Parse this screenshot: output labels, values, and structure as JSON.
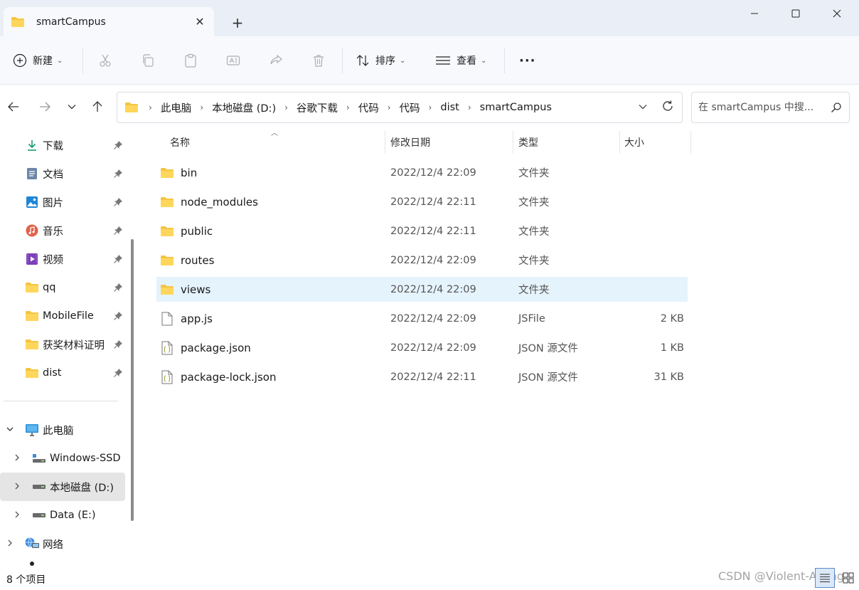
{
  "window": {
    "tab_title": "smartCampus",
    "tab_close_glyph": "✕",
    "new_tab_glyph": "+"
  },
  "toolbar": {
    "new_label": "新建",
    "sort_label": "排序",
    "view_label": "查看",
    "more_glyph": "···"
  },
  "address": {
    "breadcrumbs": [
      "此电脑",
      "本地磁盘 (D:)",
      "谷歌下载",
      "代码",
      "代码",
      "dist",
      "smartCampus"
    ]
  },
  "search": {
    "placeholder": "在 smartCampus 中搜..."
  },
  "sidebar": {
    "quick_access": [
      {
        "label": "下载",
        "icon": "download-icon"
      },
      {
        "label": "文档",
        "icon": "document-icon"
      },
      {
        "label": "图片",
        "icon": "pictures-icon"
      },
      {
        "label": "音乐",
        "icon": "music-icon"
      },
      {
        "label": "视频",
        "icon": "video-icon"
      },
      {
        "label": "qq",
        "icon": "folder-icon"
      },
      {
        "label": "MobileFile",
        "icon": "folder-icon"
      },
      {
        "label": "获奖材料证明",
        "icon": "folder-icon"
      },
      {
        "label": "dist",
        "icon": "folder-icon"
      }
    ],
    "tree": [
      {
        "label": "此电脑",
        "icon": "computer-icon",
        "expander": "expanded"
      },
      {
        "label": "Windows-SSD",
        "icon": "drive-icon",
        "expander": "collapsed"
      },
      {
        "label": "本地磁盘 (D:)",
        "icon": "drive-icon",
        "expander": "collapsed",
        "selected": true
      },
      {
        "label": "Data (E:)",
        "icon": "drive-icon",
        "expander": "collapsed"
      },
      {
        "label": "网络",
        "icon": "network-icon",
        "expander": "collapsed"
      }
    ]
  },
  "filelist": {
    "columns": {
      "name": "名称",
      "date": "修改日期",
      "type": "类型",
      "size": "大小"
    },
    "rows": [
      {
        "name": "bin",
        "date": "2022/12/4 22:09",
        "type": "文件夹",
        "size": "",
        "icon": "folder-icon"
      },
      {
        "name": "node_modules",
        "date": "2022/12/4 22:11",
        "type": "文件夹",
        "size": "",
        "icon": "folder-icon"
      },
      {
        "name": "public",
        "date": "2022/12/4 22:11",
        "type": "文件夹",
        "size": "",
        "icon": "folder-icon"
      },
      {
        "name": "routes",
        "date": "2022/12/4 22:09",
        "type": "文件夹",
        "size": "",
        "icon": "folder-icon"
      },
      {
        "name": "views",
        "date": "2022/12/4 22:09",
        "type": "文件夹",
        "size": "",
        "icon": "folder-icon",
        "hover": true
      },
      {
        "name": "app.js",
        "date": "2022/12/4 22:09",
        "type": "JSFile",
        "size": "2 KB",
        "icon": "file-icon"
      },
      {
        "name": "package.json",
        "date": "2022/12/4 22:09",
        "type": "JSON 源文件",
        "size": "1 KB",
        "icon": "json-file-icon"
      },
      {
        "name": "package-lock.json",
        "date": "2022/12/4 22:11",
        "type": "JSON 源文件",
        "size": "31 KB",
        "icon": "json-file-icon"
      }
    ]
  },
  "status": {
    "item_count": "8 个项目"
  },
  "watermark": "CSDN @Violent-Ayang",
  "colors": {
    "accent": "#0067c0",
    "folder": "#f4c542",
    "hover_row": "#e5f3fd",
    "selected_nav": "#e5e5e5"
  }
}
